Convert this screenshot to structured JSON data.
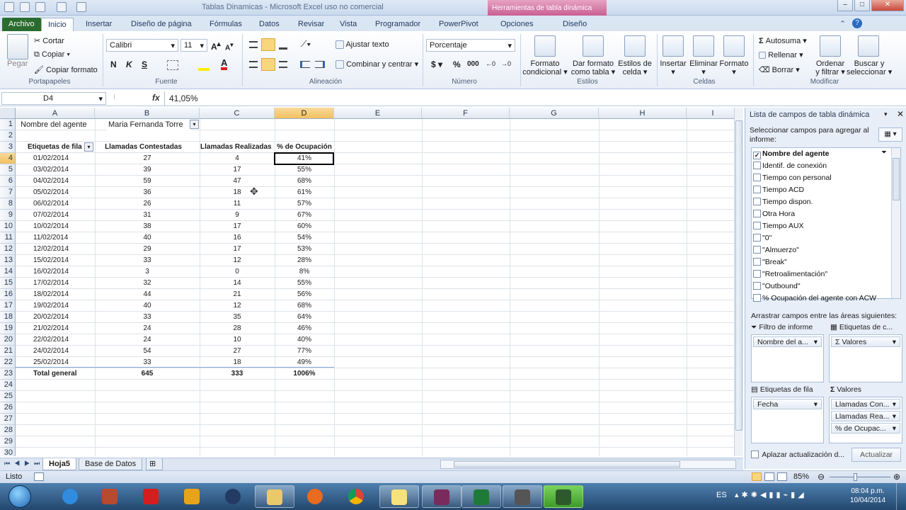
{
  "window": {
    "title": "Tablas Dinamicas - Microsoft Excel uso no comercial",
    "contextual_tab": "Herramientas de tabla dinámica",
    "controls": [
      "–",
      "□",
      "✕"
    ]
  },
  "ribbon_tabs": [
    "Archivo",
    "Inicio",
    "Insertar",
    "Diseño de página",
    "Fórmulas",
    "Datos",
    "Revisar",
    "Vista",
    "Programador",
    "PowerPivot",
    "Opciones",
    "Diseño"
  ],
  "ribbon": {
    "portapapeles": {
      "label": "Portapapeles",
      "pegar": "Pegar",
      "cortar": "Cortar",
      "copiar": "Copiar",
      "copiar_formato": "Copiar formato"
    },
    "fuente": {
      "label": "Fuente",
      "font": "Calibri",
      "size": "11",
      "bold": "N",
      "italic": "K",
      "underline": "S"
    },
    "alineacion": {
      "label": "Alineación",
      "ajustar": "Ajustar texto",
      "combinar": "Combinar y centrar"
    },
    "numero": {
      "label": "Número",
      "format": "Porcentaje",
      "currency": "$",
      "percent": "%",
      "thousands": "000"
    },
    "estilos": {
      "label": "Estilos",
      "formato_condicional": [
        "Formato",
        "condicional"
      ],
      "dar_formato": [
        "Dar formato",
        "como tabla"
      ],
      "estilos_celda": [
        "Estilos de",
        "celda"
      ]
    },
    "celdas": {
      "label": "Celdas",
      "insertar": "Insertar",
      "eliminar": "Eliminar",
      "formato": "Formato"
    },
    "modificar": {
      "label": "Modificar",
      "autosuma": "Autosuma",
      "rellenar": "Rellenar",
      "borrar": "Borrar",
      "ordenar": [
        "Ordenar",
        "y filtrar"
      ],
      "buscar": [
        "Buscar y",
        "seleccionar"
      ]
    }
  },
  "formula_bar": {
    "name_box": "D4",
    "fx": "fx",
    "value": "41,05%"
  },
  "columns": [
    "A",
    "B",
    "C",
    "D",
    "E",
    "F",
    "G",
    "H",
    "I"
  ],
  "sheet": {
    "filter_label": "Nombre del agente",
    "filter_value": "Maria Fernanda Torre",
    "headers": [
      "Etiquetas de fila",
      "Llamadas Contestadas",
      "Llamadas Realizadas",
      "% de Ocupación"
    ],
    "rows": [
      [
        "01/02/2014",
        "27",
        "4",
        "41%"
      ],
      [
        "03/02/2014",
        "39",
        "17",
        "55%"
      ],
      [
        "04/02/2014",
        "59",
        "47",
        "68%"
      ],
      [
        "05/02/2014",
        "36",
        "18",
        "61%"
      ],
      [
        "06/02/2014",
        "26",
        "11",
        "57%"
      ],
      [
        "07/02/2014",
        "31",
        "9",
        "67%"
      ],
      [
        "10/02/2014",
        "38",
        "17",
        "60%"
      ],
      [
        "11/02/2014",
        "40",
        "16",
        "54%"
      ],
      [
        "12/02/2014",
        "29",
        "17",
        "53%"
      ],
      [
        "15/02/2014",
        "33",
        "12",
        "28%"
      ],
      [
        "16/02/2014",
        "3",
        "0",
        "8%"
      ],
      [
        "17/02/2014",
        "32",
        "14",
        "55%"
      ],
      [
        "18/02/2014",
        "44",
        "21",
        "56%"
      ],
      [
        "19/02/2014",
        "40",
        "12",
        "68%"
      ],
      [
        "20/02/2014",
        "33",
        "35",
        "64%"
      ],
      [
        "21/02/2014",
        "24",
        "28",
        "46%"
      ],
      [
        "22/02/2014",
        "24",
        "10",
        "40%"
      ],
      [
        "24/02/2014",
        "54",
        "27",
        "77%"
      ],
      [
        "25/02/2014",
        "33",
        "18",
        "49%"
      ]
    ],
    "total": [
      "Total general",
      "645",
      "333",
      "1006%"
    ],
    "row_numbers": [
      "1",
      "2",
      "3",
      "4",
      "5",
      "6",
      "7",
      "8",
      "9",
      "10",
      "11",
      "12",
      "13",
      "14",
      "15",
      "16",
      "17",
      "18",
      "19",
      "20",
      "21",
      "22",
      "23",
      "24",
      "25",
      "26",
      "27",
      "28",
      "29",
      "30"
    ]
  },
  "sheet_tabs": [
    "Hoja5",
    "Base de Datos"
  ],
  "status": {
    "ready": "Listo",
    "zoom": "85%"
  },
  "pivot_panel": {
    "title": "Lista de campos de tabla dinámica",
    "choose_label": "Seleccionar campos para agregar al informe:",
    "fields": [
      {
        "name": "Nombre del agente",
        "checked": true
      },
      {
        "name": "Identif. de conexión",
        "checked": false
      },
      {
        "name": "Tiempo con personal",
        "checked": false
      },
      {
        "name": "Tiempo ACD",
        "checked": false
      },
      {
        "name": "Tiempo dispon.",
        "checked": false
      },
      {
        "name": "Otra Hora",
        "checked": false
      },
      {
        "name": "Tiempo AUX",
        "checked": false
      },
      {
        "name": "\"0\"",
        "checked": false
      },
      {
        "name": "\"Almuerzo\"",
        "checked": false
      },
      {
        "name": "\"Break\"",
        "checked": false
      },
      {
        "name": "\"Retroalimentación\"",
        "checked": false
      },
      {
        "name": "\"Outbound\"",
        "checked": false
      },
      {
        "name": "% Ocupación del agente con ACW",
        "checked": false
      }
    ],
    "drag_label": "Arrastrar campos entre las áreas siguientes:",
    "filtro_label": "Filtro de informe",
    "columnas_label": "Etiquetas de c...",
    "filas_label": "Etiquetas de fila",
    "valores_label": "Valores",
    "filtro_item": "Nombre del a...",
    "columnas_item": "Valores",
    "filas_item": "Fecha",
    "valores_items": [
      "Llamadas Con...",
      "Llamadas Rea...",
      "% de Ocupac..."
    ],
    "defer_label": "Aplazar actualización d...",
    "update_button": "Actualizar"
  },
  "taskbar": {
    "lang": "ES",
    "time": "08:04 p.m.",
    "date": "10/04/2014"
  }
}
